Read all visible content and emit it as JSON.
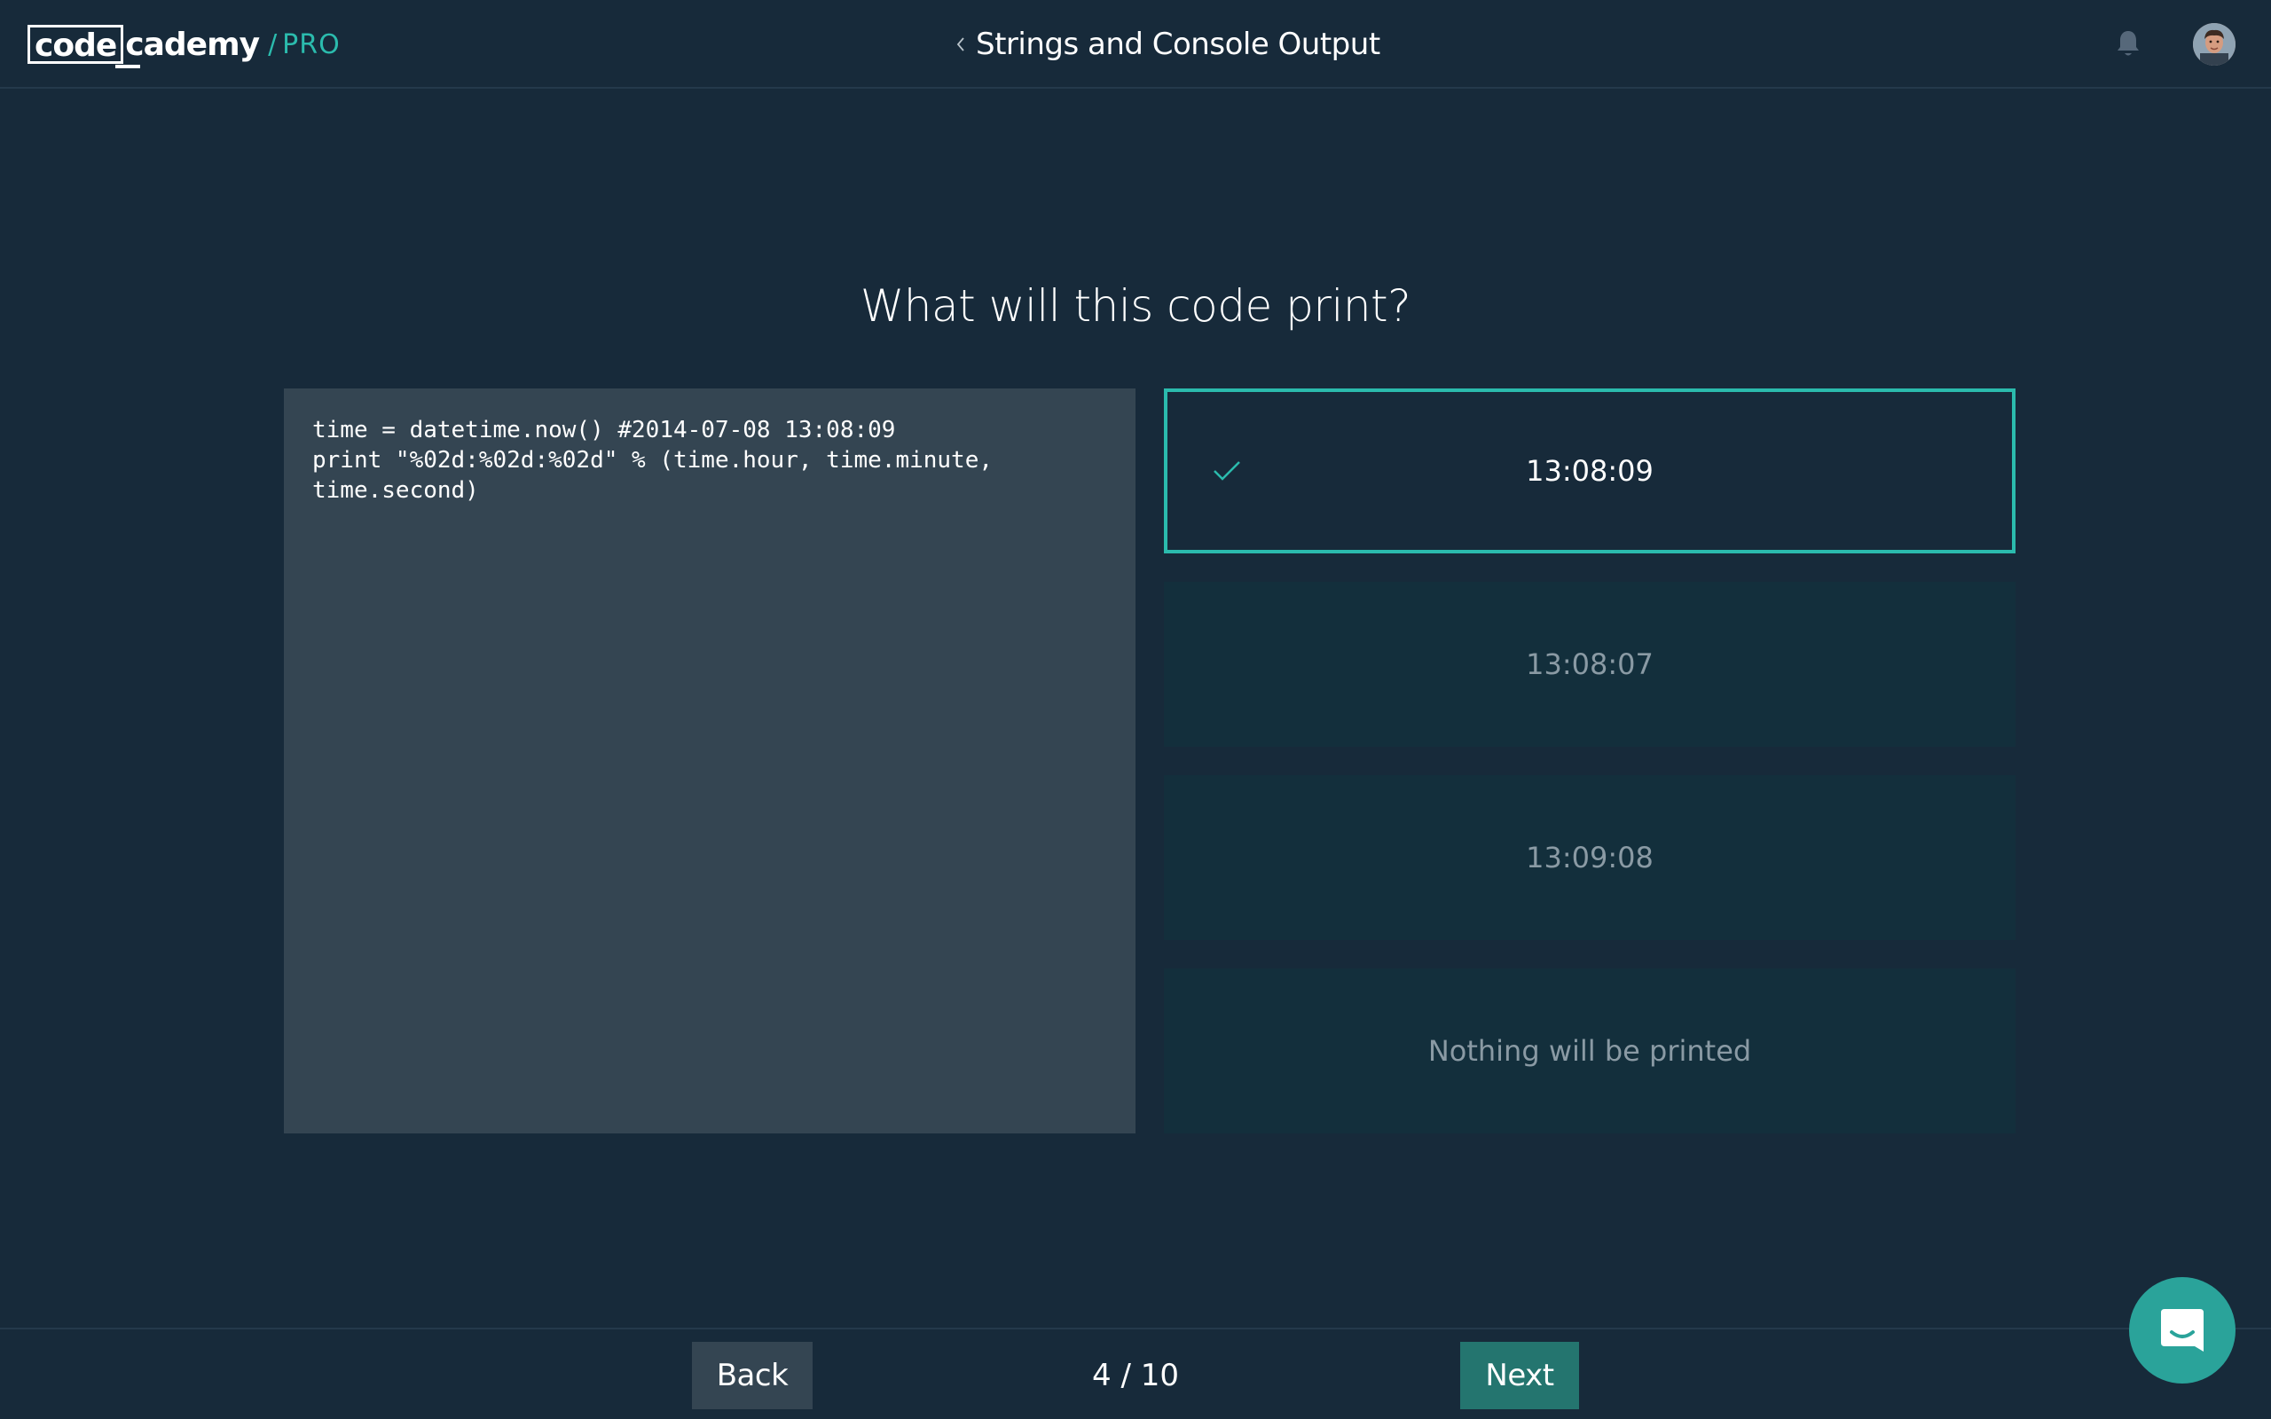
{
  "header": {
    "logo": {
      "code": "code",
      "cademy": "cademy",
      "slash": "/",
      "pro": "PRO"
    },
    "title": "Strings and Console Output",
    "icons": {
      "back": "chevron-left-icon",
      "notifications": "bell-icon",
      "profile": "avatar"
    }
  },
  "question": {
    "prompt": "What will this code print?",
    "code": "time = datetime.now() #2014-07-08 13:08:09\nprint \"%02d:%02d:%02d\" % (time.hour, time.minute,\ntime.second)"
  },
  "answers": [
    {
      "label": "13:08:09",
      "selected": true
    },
    {
      "label": "13:08:07",
      "selected": false
    },
    {
      "label": "13:09:08",
      "selected": false
    },
    {
      "label": "Nothing will be printed",
      "selected": false
    }
  ],
  "footer": {
    "back_label": "Back",
    "next_label": "Next",
    "progress": "4 / 10"
  },
  "colors": {
    "background": "#172a3a",
    "accent": "#2bbbad",
    "code_panel": "#344552",
    "answer_bg": "#132f3c",
    "next_button": "#24756f",
    "chat_button": "#2aa39a"
  }
}
